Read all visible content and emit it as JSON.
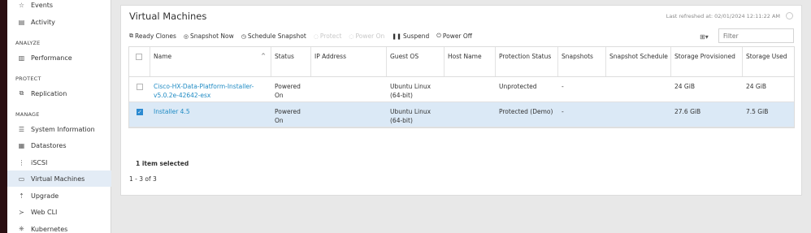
{
  "sidebar": {
    "items_top": [
      {
        "label": "Events",
        "icon": "star-icon"
      },
      {
        "label": "Activity",
        "icon": "activity-icon"
      }
    ],
    "sections": [
      {
        "title": "ANALYZE",
        "items": [
          {
            "label": "Performance",
            "icon": "chart-icon"
          }
        ]
      },
      {
        "title": "PROTECT",
        "items": [
          {
            "label": "Replication",
            "icon": "replication-icon"
          }
        ]
      },
      {
        "title": "MANAGE",
        "items": [
          {
            "label": "System Information",
            "icon": "system-info-icon"
          },
          {
            "label": "Datastores",
            "icon": "datastore-icon"
          },
          {
            "label": "iSCSI",
            "icon": "iscsi-icon"
          },
          {
            "label": "Virtual Machines",
            "icon": "monitor-icon",
            "active": true
          },
          {
            "label": "Upgrade",
            "icon": "upgrade-icon"
          },
          {
            "label": "Web CLI",
            "icon": "terminal-icon"
          },
          {
            "label": "Kubernetes",
            "icon": "kubernetes-icon"
          }
        ]
      }
    ]
  },
  "panel": {
    "title": "Virtual Machines",
    "last_refreshed": "Last refreshed at: 02/01/2024 12:11:22 AM"
  },
  "toolbar": {
    "ready_clones": "Ready Clones",
    "snapshot_now": "Snapshot Now",
    "schedule_snapshot": "Schedule Snapshot",
    "protect": "Protect",
    "power_on": "Power On",
    "suspend": "Suspend",
    "power_off": "Power Off",
    "filter_placeholder": "Filter"
  },
  "table": {
    "columns": [
      "Name",
      "Status",
      "IP Address",
      "Guest OS",
      "Host Name",
      "Protection Status",
      "Snapshots",
      "Snapshot Schedule",
      "Storage Provisioned",
      "Storage Used"
    ],
    "rows": [
      {
        "name": "Cisco-HX-Data-Platform-Installer-v5.0.2e-42642-esx",
        "status": "Powered On",
        "ip": "",
        "guest_os": "Ubuntu Linux (64-bit)",
        "host": "",
        "protection": "Unprotected",
        "snapshots": "-",
        "schedule": "",
        "provisioned": "24 GiB",
        "used": "24 GiB",
        "selected": false
      },
      {
        "name": "Installer 4.5",
        "status": "Powered On",
        "ip": "",
        "guest_os": "Ubuntu Linux (64-bit)",
        "host": "",
        "protection": "Protected (Demo)",
        "snapshots": "-",
        "schedule": "",
        "provisioned": "27.6 GiB",
        "used": "7.5 GiB",
        "selected": true
      }
    ]
  },
  "footer": {
    "selected_text": "1 item selected",
    "pagination": "1 - 3 of 3"
  },
  "colors": {
    "accent": "#1f8bc4",
    "selected_row": "#dbe9f6",
    "active_nav": "#e3ecf6"
  }
}
